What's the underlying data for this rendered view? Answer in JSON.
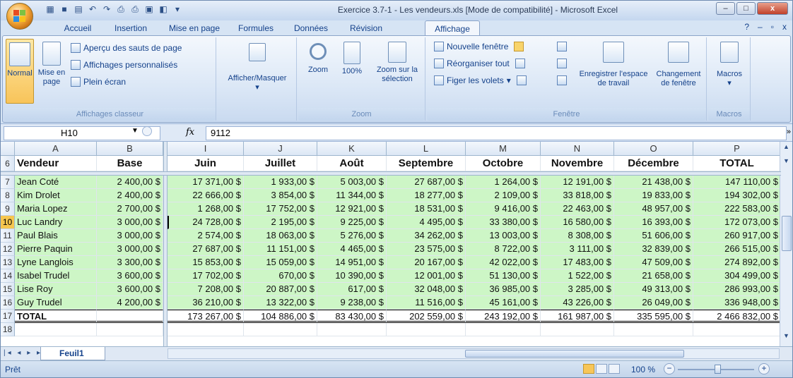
{
  "window": {
    "title": "Exercice 3.7-1 - Les vendeurs.xls  [Mode de compatibilité] - Microsoft Excel",
    "minimize": "–",
    "maximize": "□",
    "close": "x"
  },
  "tabs": [
    "Accueil",
    "Insertion",
    "Mise en page",
    "Formules",
    "Données",
    "Révision",
    "Affichage"
  ],
  "active_tab": "Affichage",
  "ribbon": {
    "group1": {
      "label": "Affichages classeur",
      "normal": "Normal",
      "mise_en_page": "Mise en page",
      "apercu": "Aperçu des sauts de page",
      "perso": "Affichages personnalisés",
      "plein": "Plein écran"
    },
    "group2": {
      "afficher": "Afficher/Masquer"
    },
    "group3": {
      "label": "Zoom",
      "zoom": "Zoom",
      "cent": "100%",
      "zoom_sel": "Zoom sur la sélection"
    },
    "group4": {
      "label": "Fenêtre",
      "nouvelle": "Nouvelle fenêtre",
      "reorganiser": "Réorganiser tout",
      "figer": "Figer les volets",
      "enregistrer": "Enregistrer l'espace de travail",
      "changement": "Changement de fenêtre"
    },
    "group5": {
      "label": "Macros",
      "macros": "Macros"
    }
  },
  "formula_bar": {
    "name_box": "H10",
    "fx": "fx",
    "value": "9112"
  },
  "columns_left": [
    "A",
    "B"
  ],
  "columns_right": [
    "I",
    "J",
    "K",
    "L",
    "M",
    "N",
    "O",
    "P"
  ],
  "header_row": {
    "row_num": "6",
    "left": [
      "Vendeur",
      "Base"
    ],
    "right": [
      "Juin",
      "Juillet",
      "Août",
      "Septembre",
      "Octobre",
      "Novembre",
      "Décembre",
      "TOTAL"
    ]
  },
  "rows": [
    {
      "num": "7",
      "name": "Jean Coté",
      "base": "2 400,00 $",
      "vals": [
        "17 371,00 $",
        "1 933,00 $",
        "5 003,00 $",
        "27 687,00 $",
        "1 264,00 $",
        "12 191,00 $",
        "21 438,00 $",
        "147 110,00 $"
      ]
    },
    {
      "num": "8",
      "name": "Kim Drolet",
      "base": "2 400,00 $",
      "vals": [
        "22 666,00 $",
        "3 854,00 $",
        "11 344,00 $",
        "18 277,00 $",
        "2 109,00 $",
        "33 818,00 $",
        "19 833,00 $",
        "194 302,00 $"
      ]
    },
    {
      "num": "9",
      "name": "Maria Lopez",
      "base": "2 700,00 $",
      "vals": [
        "1 268,00 $",
        "17 752,00 $",
        "12 921,00 $",
        "18 531,00 $",
        "9 416,00 $",
        "22 463,00 $",
        "48 957,00 $",
        "222 583,00 $"
      ]
    },
    {
      "num": "10",
      "name": "Luc Landry",
      "base": "3 000,00 $",
      "vals": [
        "24 728,00 $",
        "2 195,00 $",
        "9 225,00 $",
        "4 495,00 $",
        "33 380,00 $",
        "16 580,00 $",
        "16 393,00 $",
        "172 073,00 $"
      ]
    },
    {
      "num": "11",
      "name": "Paul Blais",
      "base": "3 000,00 $",
      "vals": [
        "2 574,00 $",
        "18 063,00 $",
        "5 276,00 $",
        "34 262,00 $",
        "13 003,00 $",
        "8 308,00 $",
        "51 606,00 $",
        "260 917,00 $"
      ]
    },
    {
      "num": "12",
      "name": "Pierre Paquin",
      "base": "3 000,00 $",
      "vals": [
        "27 687,00 $",
        "11 151,00 $",
        "4 465,00 $",
        "23 575,00 $",
        "8 722,00 $",
        "3 111,00 $",
        "32 839,00 $",
        "266 515,00 $"
      ]
    },
    {
      "num": "13",
      "name": "Lyne Langlois",
      "base": "3 300,00 $",
      "vals": [
        "15 853,00 $",
        "15 059,00 $",
        "14 951,00 $",
        "20 167,00 $",
        "42 022,00 $",
        "17 483,00 $",
        "47 509,00 $",
        "274 892,00 $"
      ]
    },
    {
      "num": "14",
      "name": "Isabel Trudel",
      "base": "3 600,00 $",
      "vals": [
        "17 702,00 $",
        "670,00 $",
        "10 390,00 $",
        "12 001,00 $",
        "51 130,00 $",
        "1 522,00 $",
        "21 658,00 $",
        "304 499,00 $"
      ]
    },
    {
      "num": "15",
      "name": "Lise Roy",
      "base": "3 600,00 $",
      "vals": [
        "7 208,00 $",
        "20 887,00 $",
        "617,00 $",
        "32 048,00 $",
        "36 985,00 $",
        "3 285,00 $",
        "49 313,00 $",
        "286 993,00 $"
      ]
    },
    {
      "num": "16",
      "name": "Guy Trudel",
      "base": "4 200,00 $",
      "vals": [
        "36 210,00 $",
        "13 322,00 $",
        "9 238,00 $",
        "11 516,00 $",
        "45 161,00 $",
        "43 226,00 $",
        "26 049,00 $",
        "336 948,00 $"
      ]
    },
    {
      "num": "17",
      "name": "TOTAL",
      "base": "",
      "vals": [
        "173 267,00 $",
        "104 886,00 $",
        "83 430,00 $",
        "202 559,00 $",
        "243 192,00 $",
        "161 987,00 $",
        "335 595,00 $",
        "2 466 832,00 $"
      ]
    },
    {
      "num": "18",
      "name": "",
      "base": "",
      "vals": [
        "",
        "",
        "",
        "",
        "",
        "",
        "",
        ""
      ]
    }
  ],
  "sheet_tab": "Feuil1",
  "status": {
    "ready": "Prêt",
    "zoom": "100 %"
  },
  "colors": {
    "green_fill": "#cdf6c6",
    "selected_row_header": "#f6c64f"
  }
}
